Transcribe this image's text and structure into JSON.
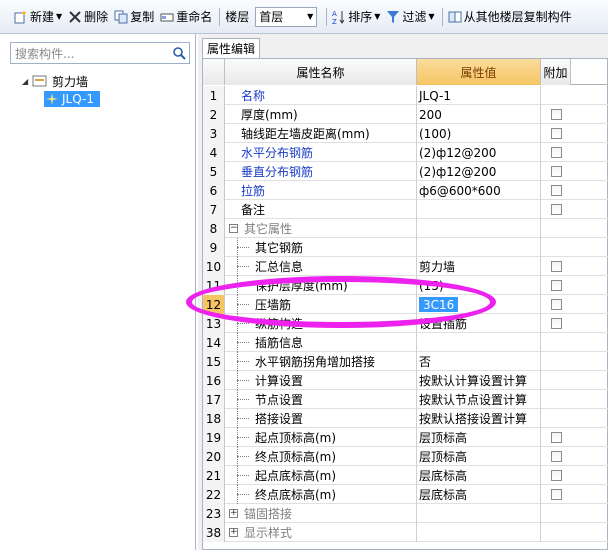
{
  "toolbar": {
    "new_label": "新建",
    "delete_label": "删除",
    "copy_label": "复制",
    "rename_label": "重命名",
    "floor_label": "楼层",
    "floor_value": "首层",
    "sort_label": "排序",
    "filter_label": "过滤",
    "copy_from_floor_label": "从其他楼层复制构件"
  },
  "search": {
    "placeholder": "搜索构件..."
  },
  "tree": {
    "root": "剪力墙",
    "child": "JLQ-1"
  },
  "tab": {
    "label": "属性编辑"
  },
  "grid": {
    "headers": {
      "name": "属性名称",
      "value": "属性值",
      "extra": "附加"
    },
    "rows": [
      {
        "num": "1",
        "name": "名称",
        "value": "JLQ-1"
      },
      {
        "num": "2",
        "name": "厚度(mm)",
        "value": "200"
      },
      {
        "num": "3",
        "name": "轴线距左墙皮距离(mm)",
        "value": "(100)"
      },
      {
        "num": "4",
        "name": "水平分布钢筋",
        "value": "(2)ф12@200"
      },
      {
        "num": "5",
        "name": "垂直分布钢筋",
        "value": "(2)ф12@200"
      },
      {
        "num": "6",
        "name": "拉筋",
        "value": "ф6@600*600"
      },
      {
        "num": "7",
        "name": "备注",
        "value": ""
      },
      {
        "num": "8",
        "name": "其它属性",
        "value": ""
      },
      {
        "num": "9",
        "name": "其它钢筋",
        "value": ""
      },
      {
        "num": "10",
        "name": "汇总信息",
        "value": "剪力墙"
      },
      {
        "num": "11",
        "name": "保护层厚度(mm)",
        "value": "(15)"
      },
      {
        "num": "12",
        "name": "压墙筋",
        "value": "3C16"
      },
      {
        "num": "13",
        "name": "纵筋构造",
        "value": "设置插筋"
      },
      {
        "num": "14",
        "name": "插筋信息",
        "value": ""
      },
      {
        "num": "15",
        "name": "水平钢筋拐角增加搭接",
        "value": "否"
      },
      {
        "num": "16",
        "name": "计算设置",
        "value": "按默认计算设置计算"
      },
      {
        "num": "17",
        "name": "节点设置",
        "value": "按默认节点设置计算"
      },
      {
        "num": "18",
        "name": "搭接设置",
        "value": "按默认搭接设置计算"
      },
      {
        "num": "19",
        "name": "起点顶标高(m)",
        "value": "层顶标高"
      },
      {
        "num": "20",
        "name": "终点顶标高(m)",
        "value": "层顶标高"
      },
      {
        "num": "21",
        "name": "起点底标高(m)",
        "value": "层底标高"
      },
      {
        "num": "22",
        "name": "终点底标高(m)",
        "value": "层底标高"
      },
      {
        "num": "23",
        "name": "锚固搭接",
        "value": ""
      },
      {
        "num": "38",
        "name": "显示样式",
        "value": ""
      }
    ]
  },
  "colors": {
    "accent_selected": "#3399ff",
    "header_value": "#f5c463",
    "annotation": "#ee22ee"
  }
}
